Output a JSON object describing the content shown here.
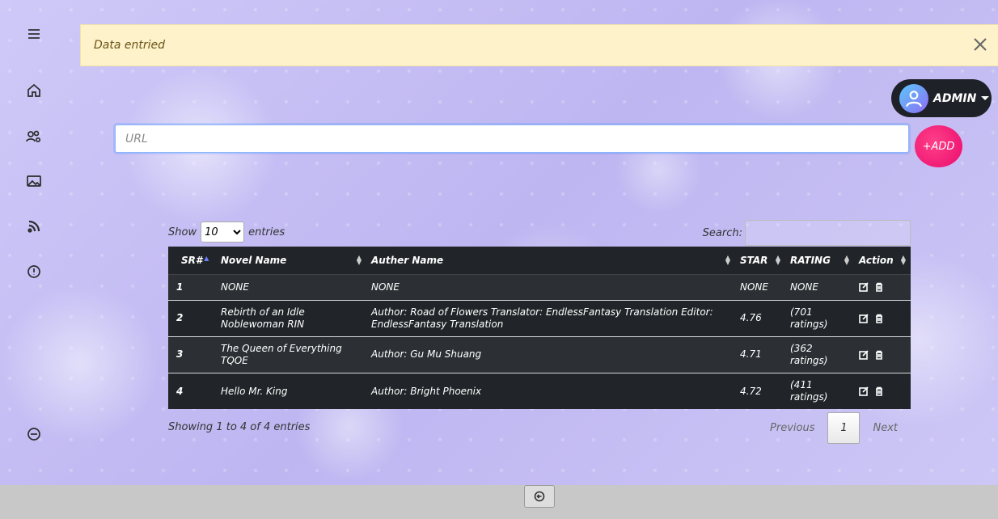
{
  "alert": {
    "message": "Data entried"
  },
  "user_menu": {
    "label": "ADMIN"
  },
  "url_input": {
    "placeholder": "URL",
    "value": ""
  },
  "add_button": {
    "label": "+ADD"
  },
  "length": {
    "prefix": "Show",
    "value": "10",
    "suffix": "entries"
  },
  "search": {
    "label": "Search:"
  },
  "table": {
    "headers": [
      "SR#",
      "Novel Name",
      "Auther Name",
      "STAR",
      "RATING",
      "Action"
    ],
    "rows": [
      {
        "sr": "1",
        "novel": "NONE",
        "author": "NONE",
        "star": "NONE",
        "rating": "NONE"
      },
      {
        "sr": "2",
        "novel": "Rebirth of an Idle Noblewoman RIN",
        "author": "Author: Road of Flowers Translator: EndlessFantasy Translation Editor: EndlessFantasy Translation",
        "star": "4.76",
        "rating": "(701 ratings)"
      },
      {
        "sr": "3",
        "novel": "The Queen of Everything TQOE",
        "author": "Author: Gu Mu Shuang",
        "star": "4.71",
        "rating": "(362 ratings)"
      },
      {
        "sr": "4",
        "novel": "Hello Mr. King",
        "author": "Author: Bright Phoenix",
        "star": "4.72",
        "rating": "(411 ratings)"
      }
    ]
  },
  "info": {
    "text": "Showing 1 to 4 of 4 entries"
  },
  "pagination": {
    "previous": "Previous",
    "page": "1",
    "next": "Next"
  },
  "sidebar": {
    "icons": [
      "menu-icon",
      "home-icon",
      "users-settings-icon",
      "image-icon",
      "rss-icon",
      "info-icon",
      "logout-icon"
    ]
  },
  "colors": {
    "accent_pink": "#ea0c6e",
    "dark": "#212529",
    "alert_bg": "#fdf2c9"
  }
}
